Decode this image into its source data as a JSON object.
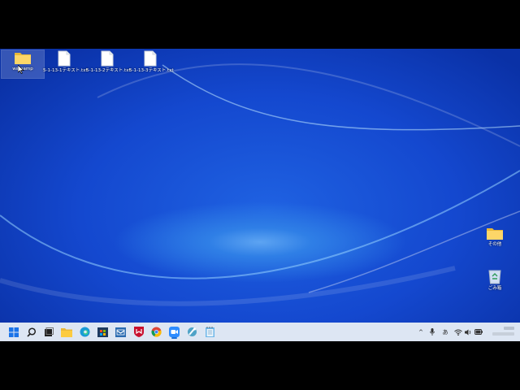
{
  "desktop": {
    "icons_left": [
      {
        "label": "wamamp",
        "icon": "folder-icon"
      },
      {
        "label": "5-1-13-1テキスト.txt",
        "icon": "text-file-icon"
      },
      {
        "label": "5-1-13-2テキスト.txt",
        "icon": "text-file-icon"
      },
      {
        "label": "5-1-13-3テキスト.txt",
        "icon": "text-file-icon"
      }
    ],
    "icons_right": [
      {
        "label": "その他",
        "icon": "folder-icon"
      },
      {
        "label": "ごみ箱",
        "icon": "recycle-bin-icon"
      }
    ]
  },
  "taskbar": {
    "apps": [
      "start-icon",
      "search-icon",
      "task-view-icon",
      "file-explorer-icon",
      "edge-icon",
      "store-icon",
      "mail-icon",
      "mcafee-icon",
      "chrome-icon",
      "zoom-icon",
      "tool-icon",
      "notepad-icon"
    ],
    "tray": {
      "chevron": "^",
      "ime": "あ"
    }
  },
  "colors": {
    "desktop_blue": "#1448cf",
    "taskbar": "#dde6f3",
    "accent": "#1b6fd8"
  }
}
